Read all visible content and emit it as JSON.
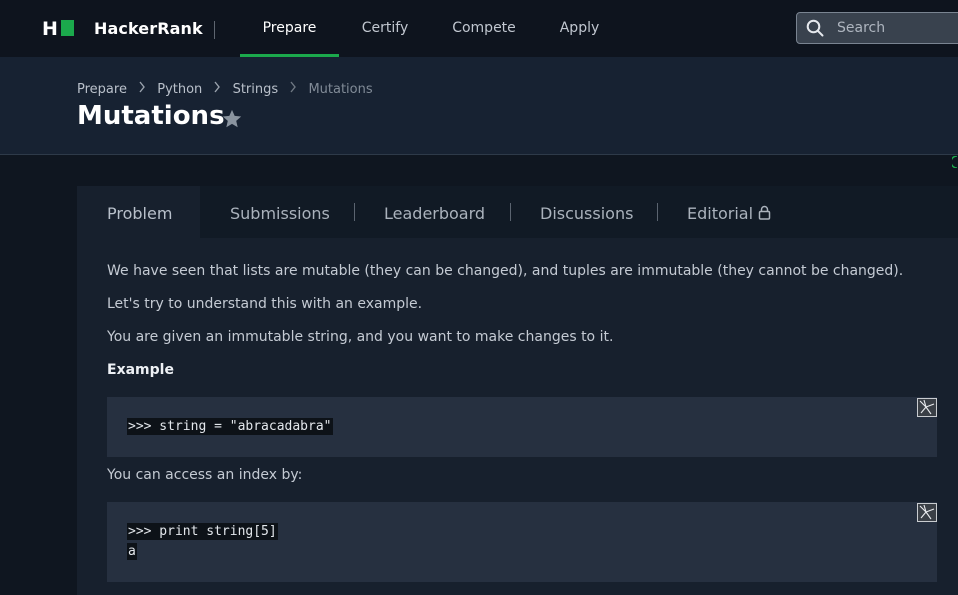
{
  "brand": {
    "logo_text": "H",
    "name": "HackerRank"
  },
  "nav": {
    "items": [
      {
        "label": "Prepare",
        "active": true
      },
      {
        "label": "Certify",
        "active": false
      },
      {
        "label": "Compete",
        "active": false
      },
      {
        "label": "Apply",
        "active": false
      }
    ]
  },
  "search": {
    "placeholder": "Search",
    "value": ""
  },
  "breadcrumb": {
    "items": [
      "Prepare",
      "Python",
      "Strings"
    ],
    "current": "Mutations"
  },
  "page": {
    "title": "Mutations",
    "starred": false
  },
  "tabs": [
    {
      "label": "Problem",
      "active": true
    },
    {
      "label": "Submissions",
      "active": false
    },
    {
      "label": "Leaderboard",
      "active": false
    },
    {
      "label": "Discussions",
      "active": false
    },
    {
      "label": "Editorial",
      "active": false,
      "locked": true
    }
  ],
  "problem": {
    "para1": "We have seen that lists are mutable (they can be changed), and tuples are immutable (they cannot be changed).",
    "para2": "Let's try to understand this with an example.",
    "para3": "You are given an immutable string, and you want to make changes to it.",
    "example_heading": "Example",
    "code1_line1": ">>> string = \"abracadabra\"",
    "para4": "You can access an index by:",
    "code2_line1": ">>> print string[5]",
    "code2_line2": "a"
  },
  "colors": {
    "accent_green": "#1ba94c",
    "nav_bg": "#0e141e",
    "header_bg": "#172232",
    "page_bg": "#0f1620",
    "code_bg": "#263040"
  },
  "icons": [
    "hackerrank-logo-icon",
    "search-icon",
    "chevron-right-icon",
    "star-icon",
    "lock-icon",
    "copy-code-icon"
  ]
}
